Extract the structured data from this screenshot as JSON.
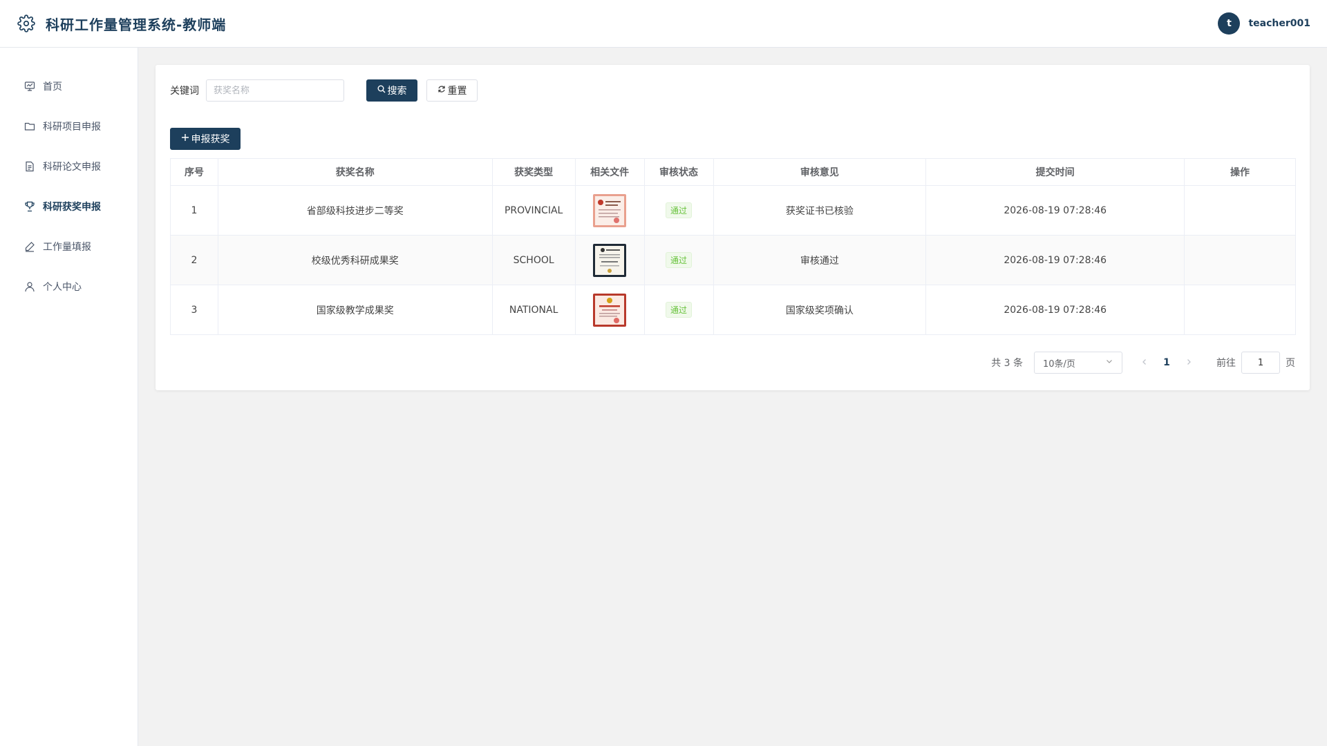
{
  "app": {
    "title": "科研工作量管理系统-教师端",
    "user_initial": "t",
    "username": "teacher001"
  },
  "sidebar": {
    "items": [
      {
        "label": "首页",
        "icon": "dashboard-icon",
        "active": false
      },
      {
        "label": "科研项目申报",
        "icon": "folder-icon",
        "active": false
      },
      {
        "label": "科研论文申报",
        "icon": "document-icon",
        "active": false
      },
      {
        "label": "科研获奖申报",
        "icon": "trophy-icon",
        "active": true
      },
      {
        "label": "工作量填报",
        "icon": "edit-icon",
        "active": false
      },
      {
        "label": "个人中心",
        "icon": "user-icon",
        "active": false
      }
    ]
  },
  "search": {
    "label": "关键词",
    "placeholder": "获奖名称",
    "value": "",
    "search_label": "搜索",
    "reset_label": "重置"
  },
  "toolbar": {
    "add_label": "申报获奖"
  },
  "table": {
    "headers": [
      "序号",
      "获奖名称",
      "获奖类型",
      "相关文件",
      "审核状态",
      "审核意见",
      "提交时间",
      "操作"
    ],
    "rows": [
      {
        "index": "1",
        "name": "省部级科技进步二等奖",
        "type": "PROVINCIAL",
        "file_style": "certificate-red-light",
        "status": "通过",
        "comment": "获奖证书已核验",
        "time": "2026-08-19 07:28:46"
      },
      {
        "index": "2",
        "name": "校级优秀科研成果奖",
        "type": "SCHOOL",
        "file_style": "certificate-black-frame",
        "status": "通过",
        "comment": "审核通过",
        "time": "2026-08-19 07:28:46"
      },
      {
        "index": "3",
        "name": "国家级教学成果奖",
        "type": "NATIONAL",
        "file_style": "certificate-red-dark",
        "status": "通过",
        "comment": "国家级奖项确认",
        "time": "2026-08-19 07:28:46"
      }
    ]
  },
  "pagination": {
    "total_text": "共 3 条",
    "page_size": "10条/页",
    "current_page": "1",
    "goto_label": "前往",
    "goto_value": "1",
    "page_unit": "页"
  },
  "colors": {
    "primary": "#1d3f5c",
    "success": "#67c23a"
  }
}
